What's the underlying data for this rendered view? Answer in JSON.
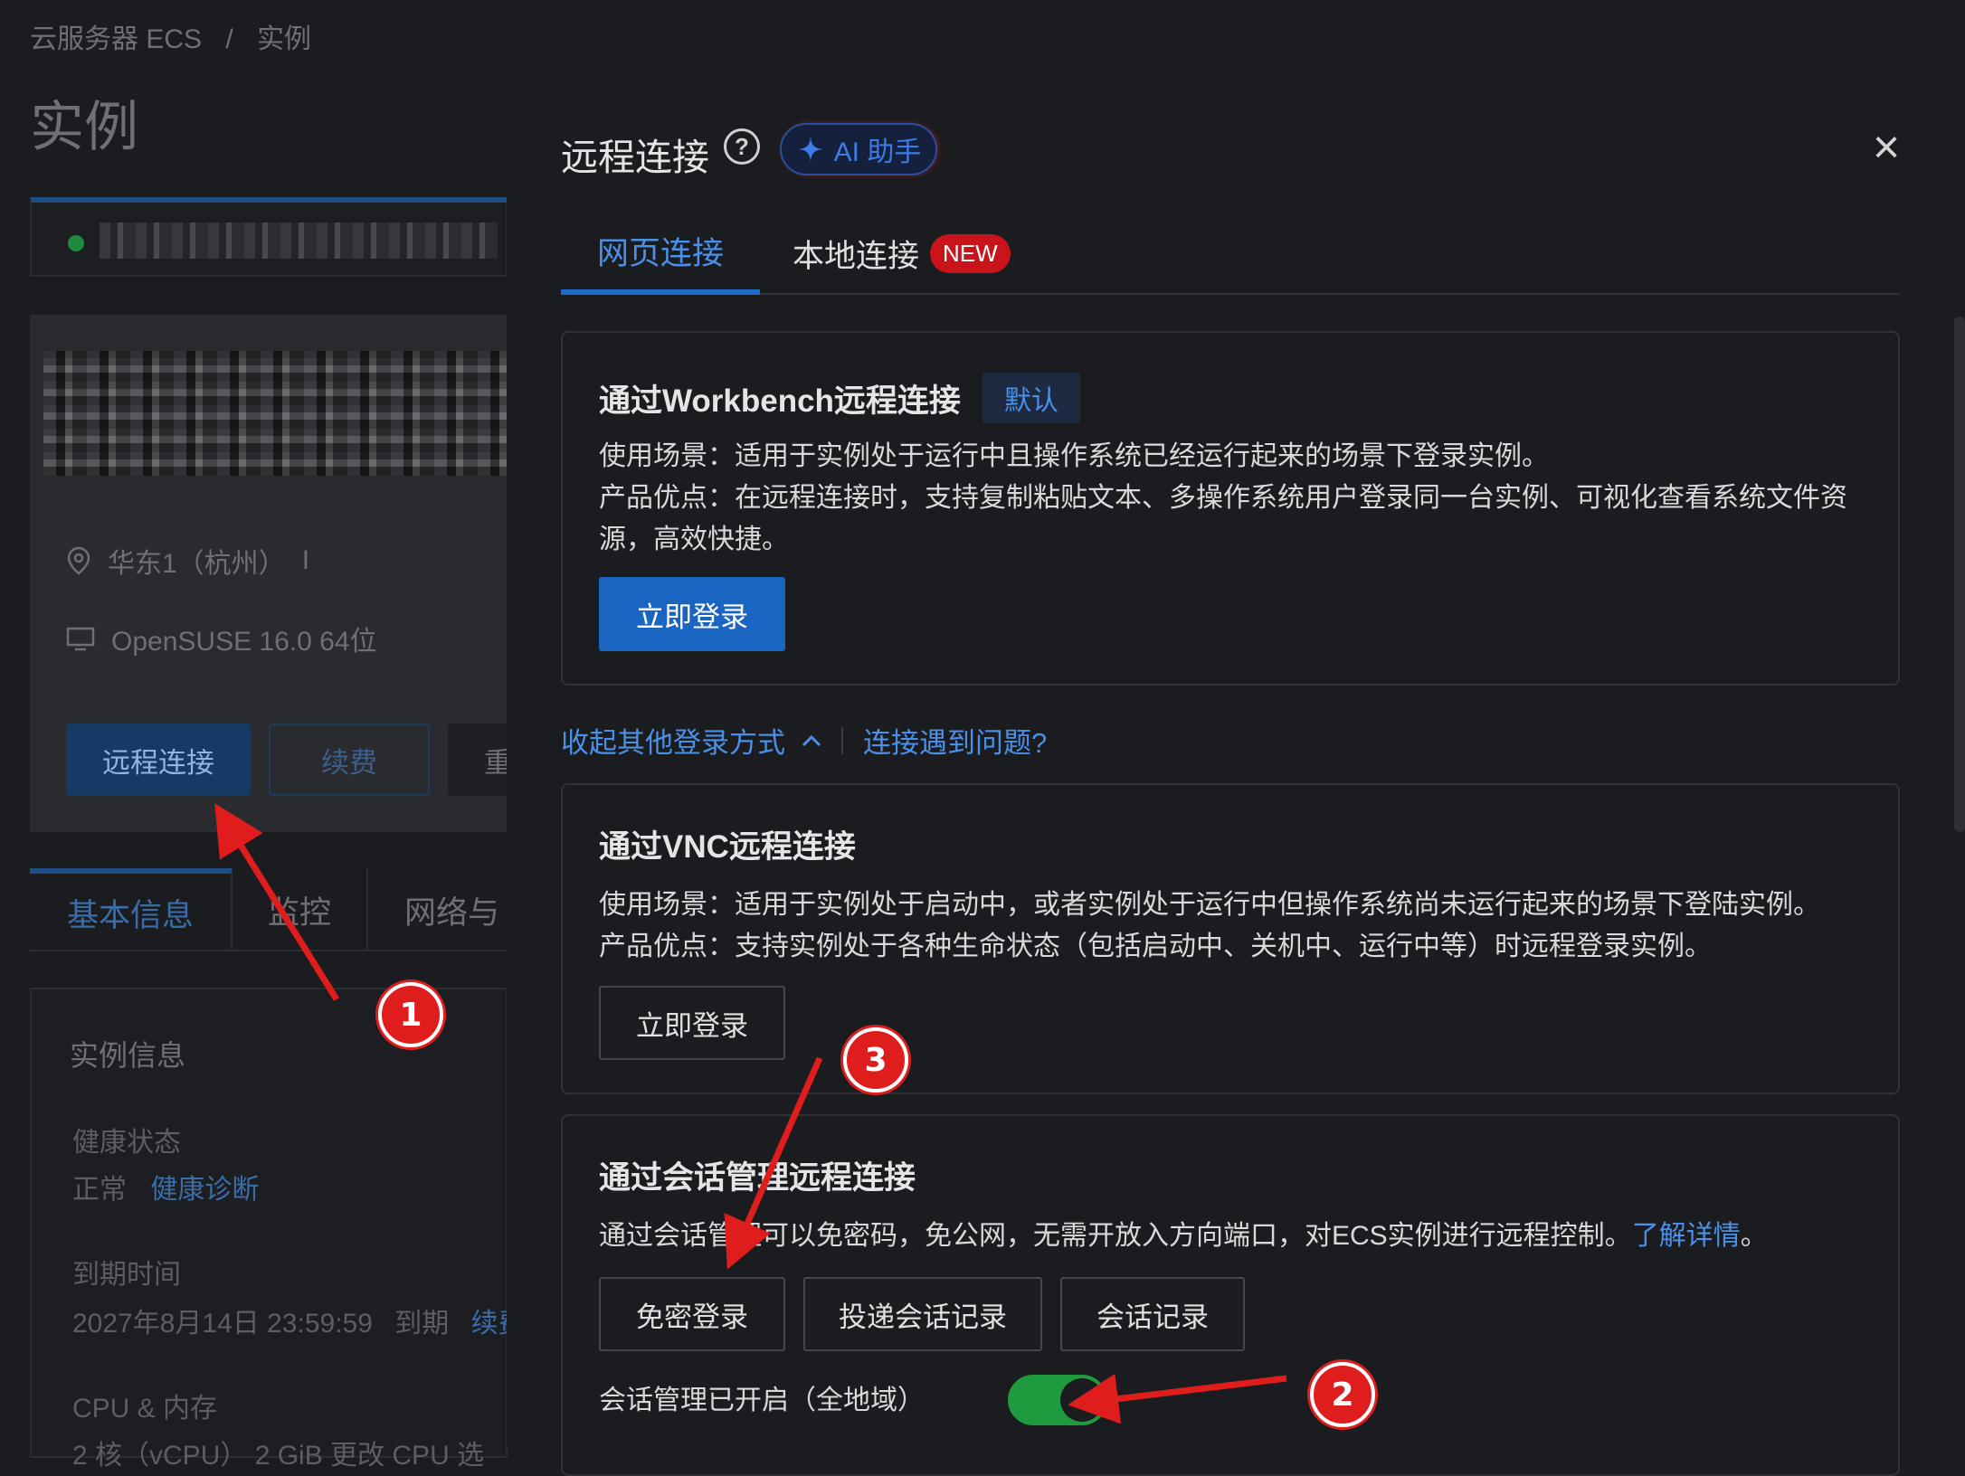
{
  "breadcrumb": {
    "root": "云服务器 ECS",
    "separator": "/",
    "current": "实例"
  },
  "page_title": "实例",
  "instance_card": {
    "region": "华东1（杭州）",
    "region_suffix": "I",
    "os": "OpenSUSE 16.0 64位",
    "btn_remote": "远程连接",
    "btn_renew": "续费",
    "btn_restart": "重启"
  },
  "left_tabs": [
    "基本信息",
    "监控",
    "网络与"
  ],
  "instance_info": {
    "title": "实例信息",
    "health_label": "健康状态",
    "health_value": "正常",
    "health_link": "健康诊断",
    "expire_label": "到期时间",
    "expire_value": "2027年8月14日 23:59:59",
    "expire_suffix": "到期",
    "expire_link": "续费",
    "cpu_label": "CPU & 内存",
    "cpu_value": "2 核（vCPU） 2 GiB 更改 CPU 选"
  },
  "panel": {
    "title": "远程连接",
    "help_glyph": "?",
    "ai_label": "AI 助手",
    "close_glyph": "×",
    "tabs": {
      "web": "网页连接",
      "local": "本地连接",
      "new_badge": "NEW"
    },
    "workbench": {
      "title": "通过Workbench远程连接",
      "badge": "默认",
      "line1": "使用场景：适用于实例处于运行中且操作系统已经运行起来的场景下登录实例。",
      "line2": "产品优点：在远程连接时，支持复制粘贴文本、多操作系统用户登录同一台实例、可视化查看系统文件资源，高效快捷。",
      "button": "立即登录"
    },
    "more": {
      "collapse": "收起其他登录方式",
      "problem": "连接遇到问题?"
    },
    "vnc": {
      "title": "通过VNC远程连接",
      "line1": "使用场景：适用于实例处于启动中，或者实例处于运行中但操作系统尚未运行起来的场景下登陆实例。",
      "line2": "产品优点：支持实例处于各种生命状态（包括启动中、关机中、运行中等）时远程登录实例。",
      "button": "立即登录"
    },
    "session": {
      "title": "通过会话管理远程连接",
      "desc": "通过会话管理可以免密码，免公网，无需开放入方向端口，对ECS实例进行远程控制。",
      "desc_link": "了解详情",
      "desc_end": "。",
      "btn_login": "免密登录",
      "btn_deliver": "投递会话记录",
      "btn_records": "会话记录",
      "toggle_label": "会话管理已开启（全地域）",
      "toggle_on": true
    }
  },
  "annotations": [
    "1",
    "2",
    "3"
  ],
  "colors": {
    "accent": "#1a65c2",
    "link": "#4a90e8",
    "toggle": "#1f9b3f",
    "marker": "#e01d1d"
  }
}
